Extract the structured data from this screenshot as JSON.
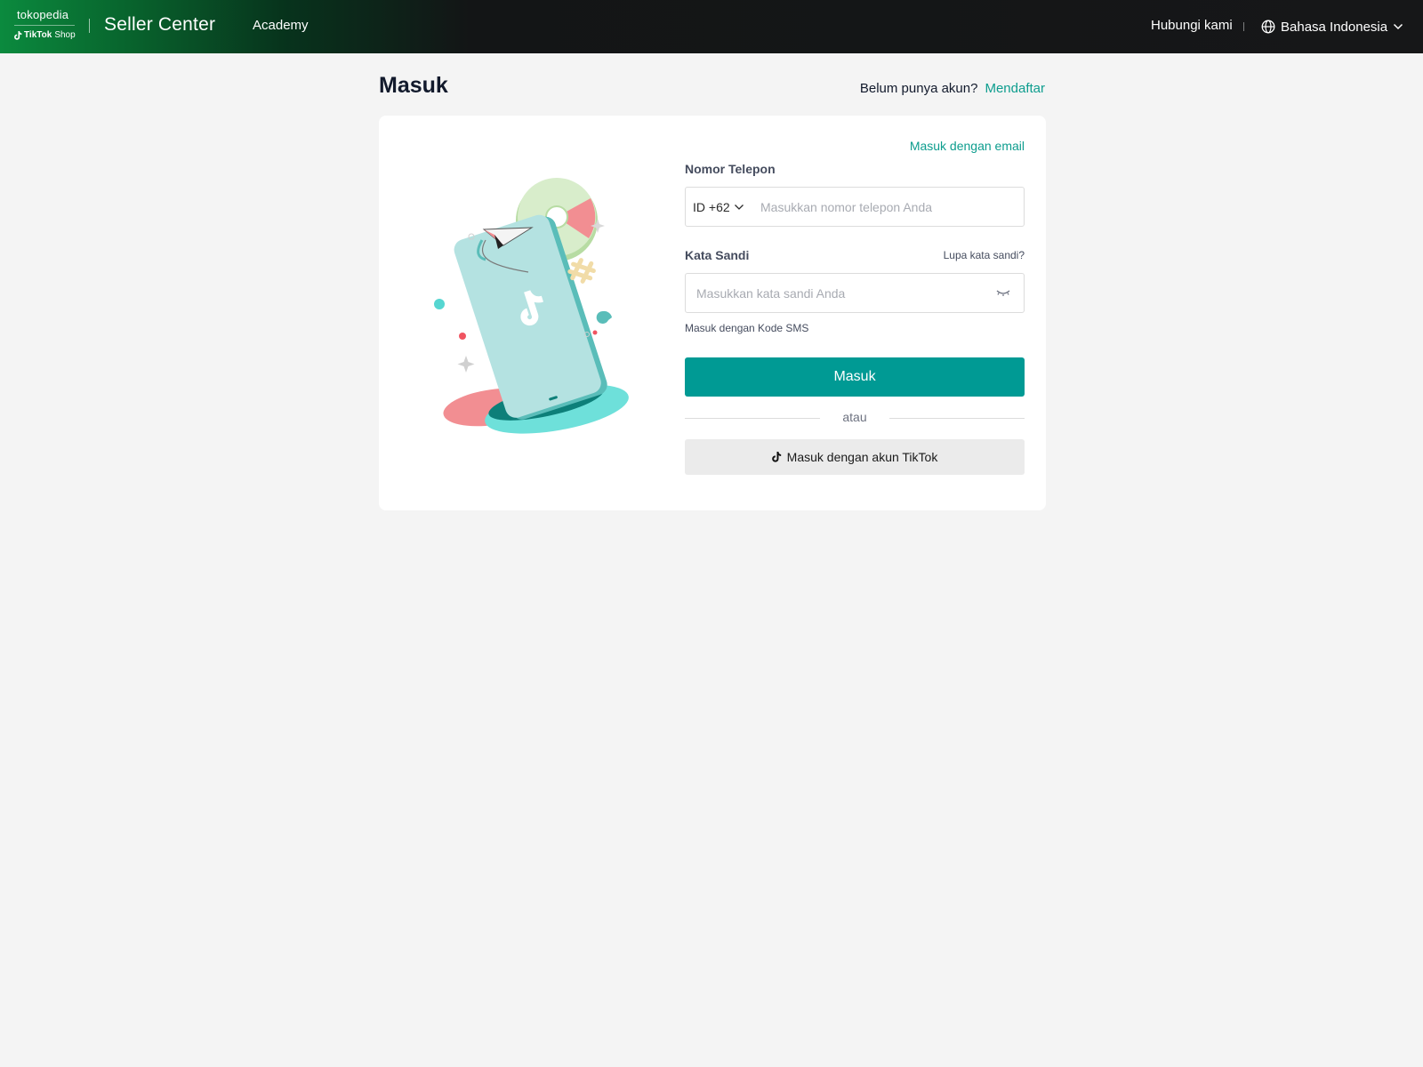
{
  "header": {
    "logo_top": "tokopedia",
    "logo_tiktok": "TikTok",
    "logo_shop": "Shop",
    "title": "Seller Center",
    "nav_academy": "Academy",
    "contact": "Hubungi kami",
    "language": "Bahasa Indonesia",
    "icons": [
      "tiktok-note-icon",
      "globe-icon",
      "chevron-down-icon"
    ]
  },
  "page": {
    "title": "Masuk",
    "signup_prompt": "Belum punya akun?",
    "signup_link": "Mendaftar"
  },
  "form": {
    "email_link": "Masuk dengan email",
    "phone_label": "Nomor Telepon",
    "country_code": "ID +62",
    "phone_placeholder": "Masukkan nomor telepon Anda",
    "phone_value": "",
    "password_label": "Kata Sandi",
    "forgot_link": "Lupa kata sandi?",
    "password_placeholder": "Masukkan kata sandi Anda",
    "password_value": "",
    "sms_link": "Masuk dengan Kode SMS",
    "submit": "Masuk",
    "divider_text": "atau",
    "tiktok_login": "Masuk dengan akun TikTok"
  },
  "colors": {
    "accent": "#009a94",
    "link": "#0d9d8e",
    "header_bg": "#161718",
    "header_green": "#0b8a3e",
    "page_bg": "#f4f4f4"
  }
}
